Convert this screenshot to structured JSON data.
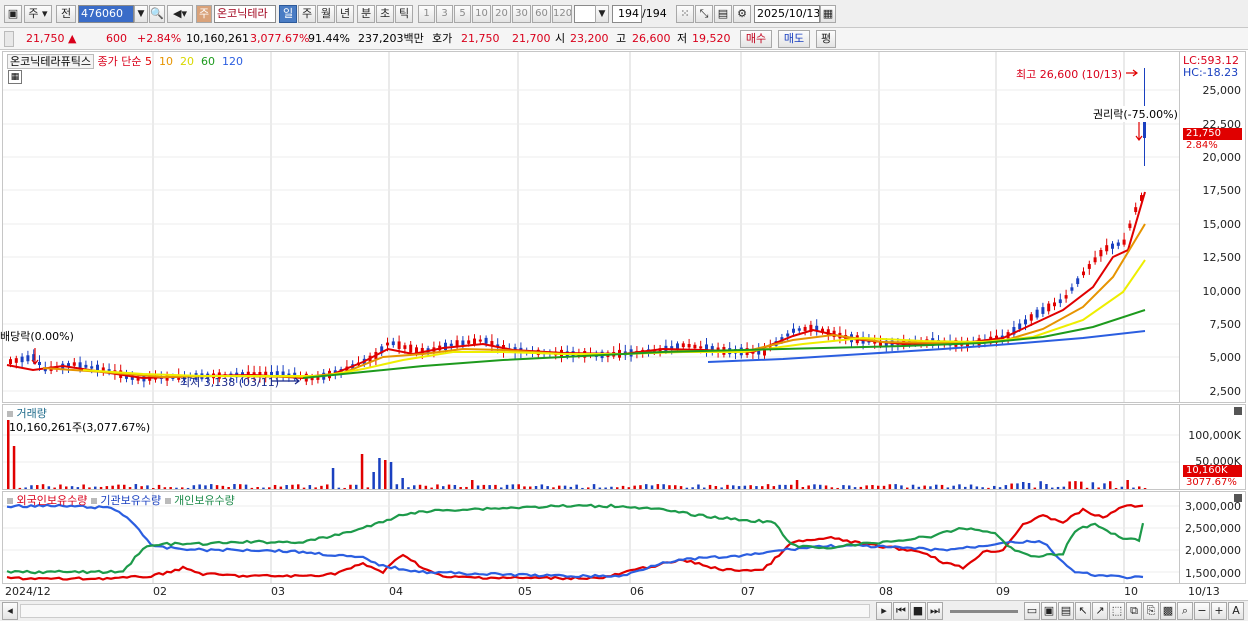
{
  "toolbar": {
    "market": "주",
    "prev_label": "전",
    "code": "476060",
    "stock_name": "온코닉테라",
    "stock_badge": "주",
    "periods": [
      "일",
      "주",
      "월",
      "년",
      "분",
      "초",
      "틱"
    ],
    "numbers": [
      "1",
      "3",
      "5",
      "10",
      "20",
      "30",
      "60",
      "120"
    ],
    "count": "194",
    "total": "/194",
    "date": "2025/10/13"
  },
  "quote": {
    "price": "21,750",
    "change": "600",
    "change_pct": "+2.84%",
    "volume": "10,160,261",
    "vol_ratio": "3,077.67%",
    "turnover": "91.44%",
    "amount": "237,203백만",
    "bid_label": "호가",
    "ask": "21,750",
    "bid": "21,700",
    "open_label": "시",
    "open": "23,200",
    "high_label": "고",
    "high": "26,600",
    "low_label": "저",
    "low": "19,520",
    "buy_label": "매수",
    "sell_label": "매도",
    "eval_label": "평"
  },
  "price_panel": {
    "title": "온코닉테라퓨틱스",
    "ma_prefix": "종가 단순",
    "ma_periods": [
      "5",
      "10",
      "20",
      "60",
      "120"
    ],
    "ma_colors": [
      "#e00000",
      "#e69400",
      "#eeee00",
      "#1d9a1d",
      "#2b5ee0"
    ],
    "high_annotation": "최고 26,600 (10/13)",
    "low_annotation": "최저 3,138 (03/11)",
    "rights_annotation": "권리락(-75.00%)",
    "div_annotation": "배당락(0.00%)",
    "lc": "LC:593.12",
    "hc": "HC:-18.23",
    "price_tag": "21,750",
    "pct_tag": "2.84%",
    "yticks": [
      "25,000",
      "22,500",
      "20,000",
      "17,500",
      "15,000",
      "12,500",
      "10,000",
      "7,500",
      "5,000",
      "2,500"
    ]
  },
  "volume_panel": {
    "title": "거래량",
    "value": "10,160,261주(3,077.67%)",
    "yticks": [
      "100,000K",
      "50,000K"
    ],
    "tag": "10,160K",
    "tag2": "3077.67%"
  },
  "holding_panel": {
    "series": [
      {
        "name": "외국인보유수량",
        "color": "#e00000"
      },
      {
        "name": "기관보유수량",
        "color": "#2b5ee0"
      },
      {
        "name": "개인보유수량",
        "color": "#1d9a4a"
      }
    ],
    "yticks": [
      "3,000,000",
      "2,500,000",
      "2,000,000",
      "1,500,000"
    ]
  },
  "xaxis": {
    "labels": [
      "2024/12",
      "02",
      "03",
      "04",
      "05",
      "06",
      "07",
      "08",
      "09",
      "10"
    ],
    "last_date": "10/13"
  }
}
